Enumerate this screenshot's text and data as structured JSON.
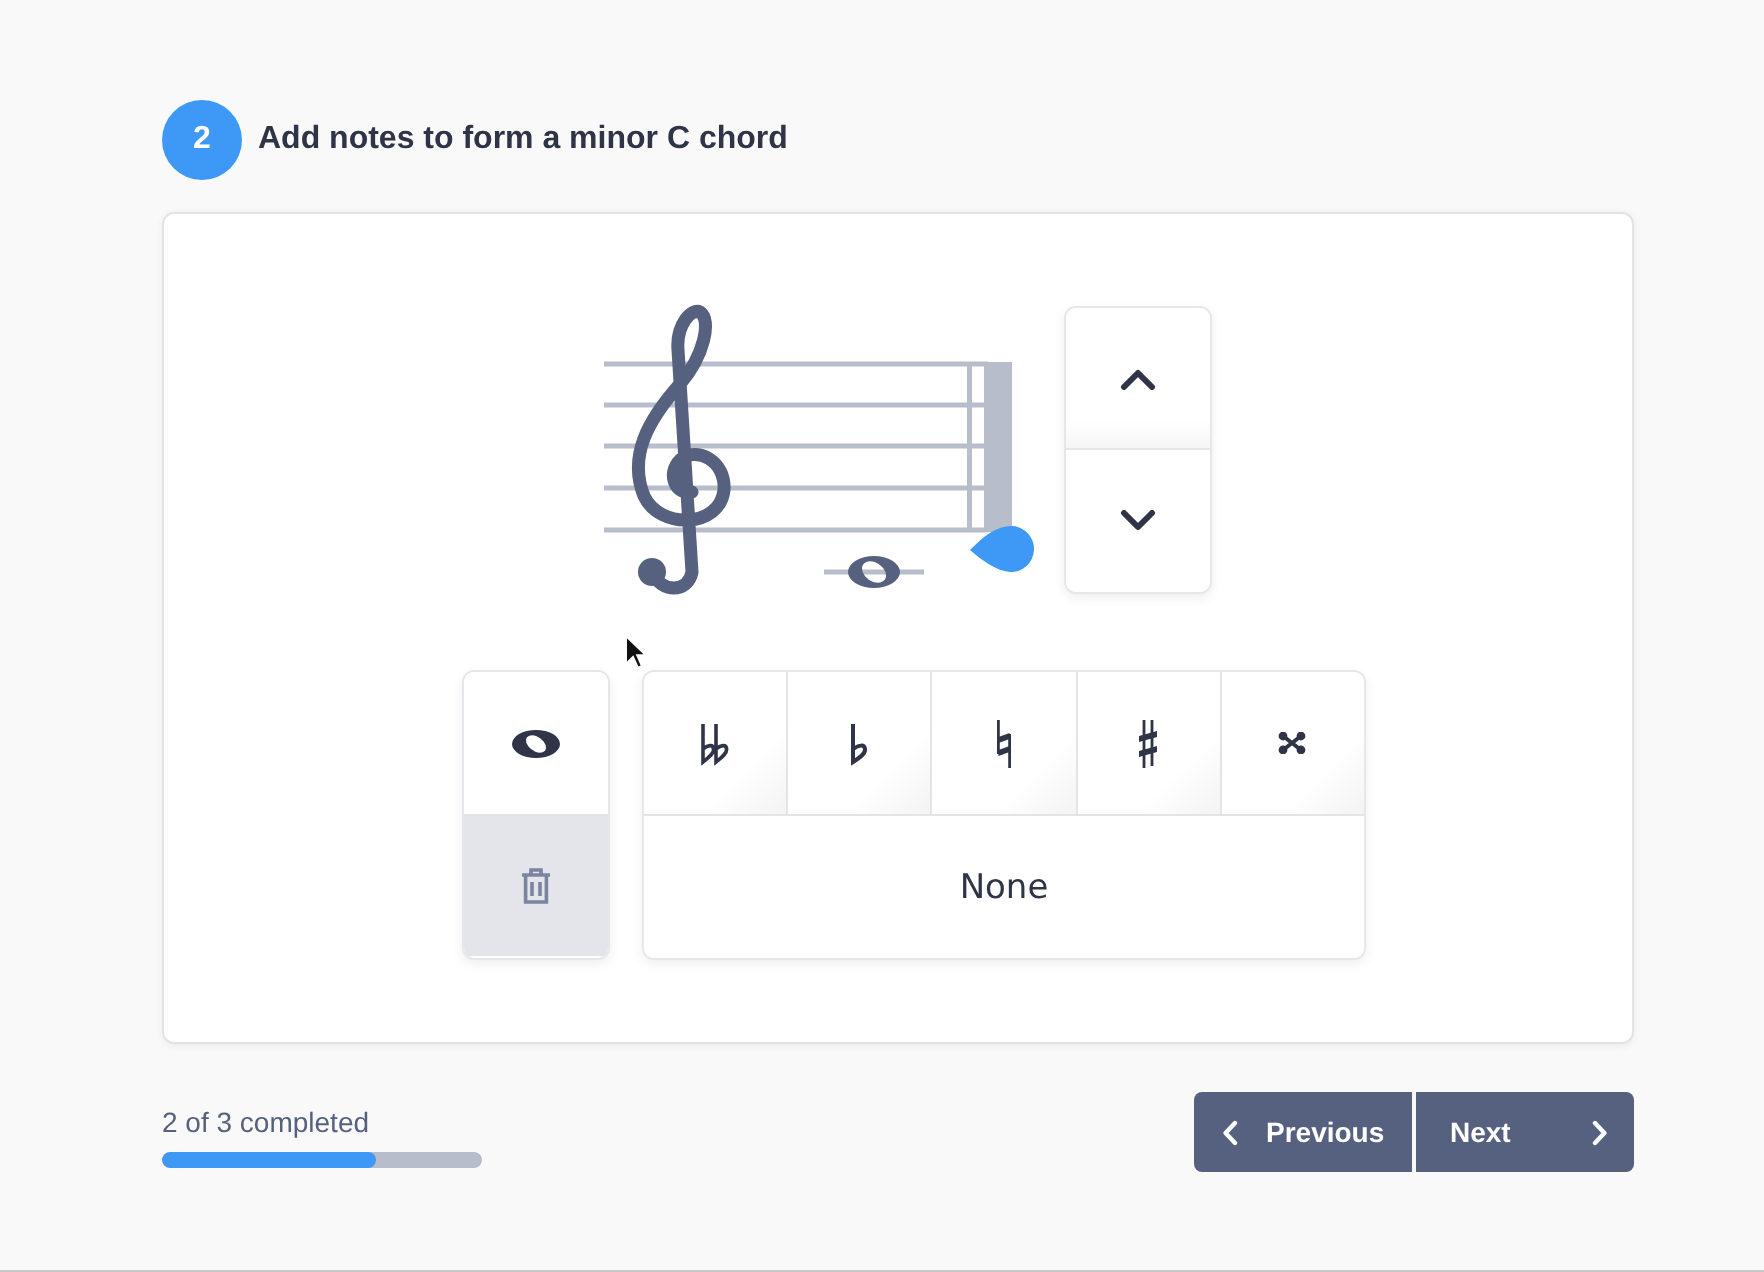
{
  "step": {
    "number": "2",
    "title": "Add notes to form a minor C chord"
  },
  "tools": [
    {
      "kind": "whole-note",
      "disabled": false
    },
    {
      "kind": "delete",
      "disabled": true
    }
  ],
  "accidentals": [
    {
      "kind": "double-flat",
      "selected": false
    },
    {
      "kind": "flat",
      "selected": false
    },
    {
      "kind": "natural",
      "selected": false
    },
    {
      "kind": "sharp",
      "selected": false
    },
    {
      "kind": "double-sharp",
      "selected": false
    }
  ],
  "accidental_none": {
    "label": "None",
    "selected": false
  },
  "progress": {
    "label": "2 of 3 completed",
    "level": 0.67
  },
  "nav": [
    {
      "kind": "previous",
      "label": "Previous"
    },
    {
      "kind": "next",
      "label": "Next"
    }
  ]
}
